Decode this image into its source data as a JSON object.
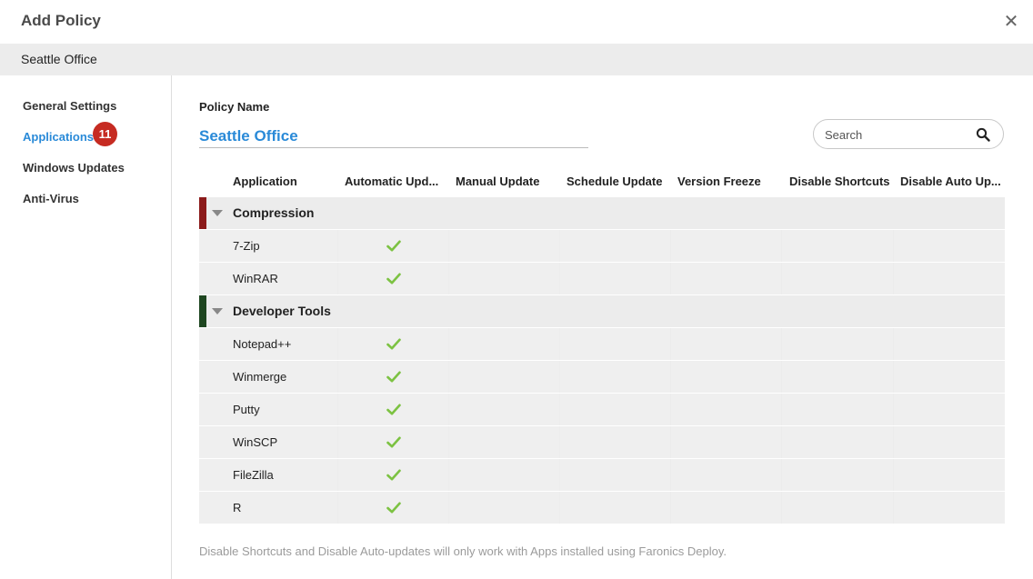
{
  "dialog": {
    "title": "Add Policy",
    "close_glyph": "✕"
  },
  "subheader": {
    "text": "Seattle Office"
  },
  "sidebar": {
    "items": [
      {
        "label": "General Settings",
        "active": false
      },
      {
        "label": "Applications",
        "active": true,
        "badge": "11"
      },
      {
        "label": "Windows Updates",
        "active": false
      },
      {
        "label": "Anti-Virus",
        "active": false
      }
    ]
  },
  "policy": {
    "label": "Policy Name",
    "value": "Seattle Office"
  },
  "search": {
    "placeholder": "Search",
    "icon": "search-icon"
  },
  "table": {
    "columns": [
      "Application",
      "Automatic Upd...",
      "Manual Update",
      "Schedule Update",
      "Version Freeze",
      "Disable Shortcuts",
      "Disable Auto Up..."
    ],
    "groups": [
      {
        "name": "Compression",
        "color": "#8b1a1a",
        "apps": [
          {
            "name": "7-Zip",
            "automatic_update": true
          },
          {
            "name": "WinRAR",
            "automatic_update": true
          }
        ]
      },
      {
        "name": "Developer Tools",
        "color": "#1e4620",
        "apps": [
          {
            "name": "Notepad++",
            "automatic_update": true
          },
          {
            "name": "Winmerge",
            "automatic_update": true
          },
          {
            "name": "Putty",
            "automatic_update": true
          },
          {
            "name": "WinSCP",
            "automatic_update": true
          },
          {
            "name": "FileZilla",
            "automatic_update": true
          },
          {
            "name": "R",
            "automatic_update": true
          }
        ]
      }
    ]
  },
  "footnote": "Disable Shortcuts and Disable Auto-updates will only work with Apps installed using Faronics Deploy.",
  "colors": {
    "accent": "#2a8ad8",
    "badge": "#c62b22",
    "check": "#7cc242"
  }
}
